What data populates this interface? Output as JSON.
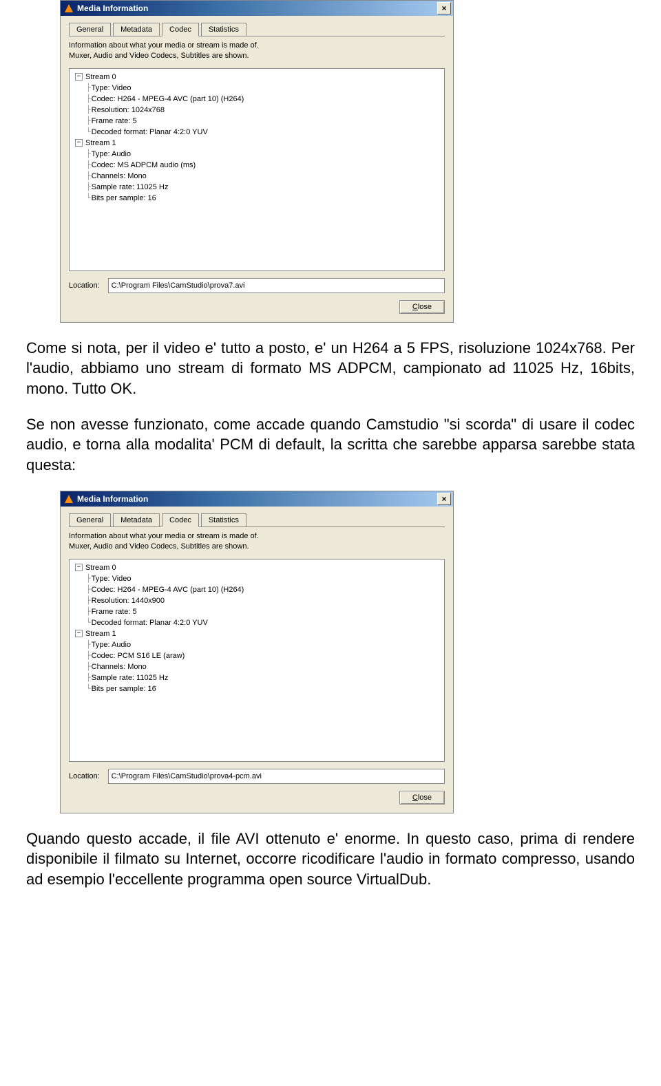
{
  "dialog1": {
    "title": "Media Information",
    "tabs": [
      "General",
      "Metadata",
      "Codec",
      "Statistics"
    ],
    "active_tab_index": 2,
    "info_line1": "Information about what your media or stream is made of.",
    "info_line2": "Muxer, Audio and Video Codecs, Subtitles are shown.",
    "tree": {
      "stream0": {
        "label": "Stream 0",
        "items": [
          "Type: Video",
          "Codec: H264 - MPEG-4 AVC (part 10) (H264)",
          "Resolution: 1024x768",
          "Frame rate: 5",
          "Decoded format: Planar 4:2:0 YUV"
        ]
      },
      "stream1": {
        "label": "Stream 1",
        "items": [
          "Type: Audio",
          "Codec: MS ADPCM audio (ms)",
          "Channels: Mono",
          "Sample rate: 11025 Hz",
          "Bits per sample: 16"
        ]
      }
    },
    "location_label": "Location:",
    "location_value": "C:\\Program Files\\CamStudio\\prova7.avi",
    "close_label": "Close"
  },
  "para1": "Come si nota, per il video e' tutto a posto, e' un H264 a 5 FPS, risoluzione 1024x768. Per l'audio, abbiamo uno stream di formato MS ADPCM, campionato ad 11025 Hz, 16bits, mono. Tutto OK.",
  "para2": "Se non avesse funzionato, come accade quando Camstudio \"si scorda\" di usare il codec audio, e torna alla modalita' PCM di default, la scritta che sarebbe apparsa sarebbe stata questa:",
  "dialog2": {
    "title": "Media Information",
    "tabs": [
      "General",
      "Metadata",
      "Codec",
      "Statistics"
    ],
    "active_tab_index": 2,
    "info_line1": "Information about what your media or stream is made of.",
    "info_line2": "Muxer, Audio and Video Codecs, Subtitles are shown.",
    "tree": {
      "stream0": {
        "label": "Stream 0",
        "items": [
          "Type: Video",
          "Codec: H264 - MPEG-4 AVC (part 10) (H264)",
          "Resolution: 1440x900",
          "Frame rate: 5",
          "Decoded format: Planar 4:2:0 YUV"
        ]
      },
      "stream1": {
        "label": "Stream 1",
        "items": [
          "Type: Audio",
          "Codec: PCM S16 LE (araw)",
          "Channels: Mono",
          "Sample rate: 11025 Hz",
          "Bits per sample: 16"
        ]
      }
    },
    "location_label": "Location:",
    "location_value": "C:\\Program Files\\CamStudio\\prova4-pcm.avi",
    "close_label": "Close"
  },
  "para3": "Quando questo accade, il file AVI ottenuto e' enorme. In questo caso, prima di rendere disponibile il filmato su Internet, occorre ricodificare l'audio in formato compresso, usando ad esempio l'eccellente programma open source VirtualDub."
}
